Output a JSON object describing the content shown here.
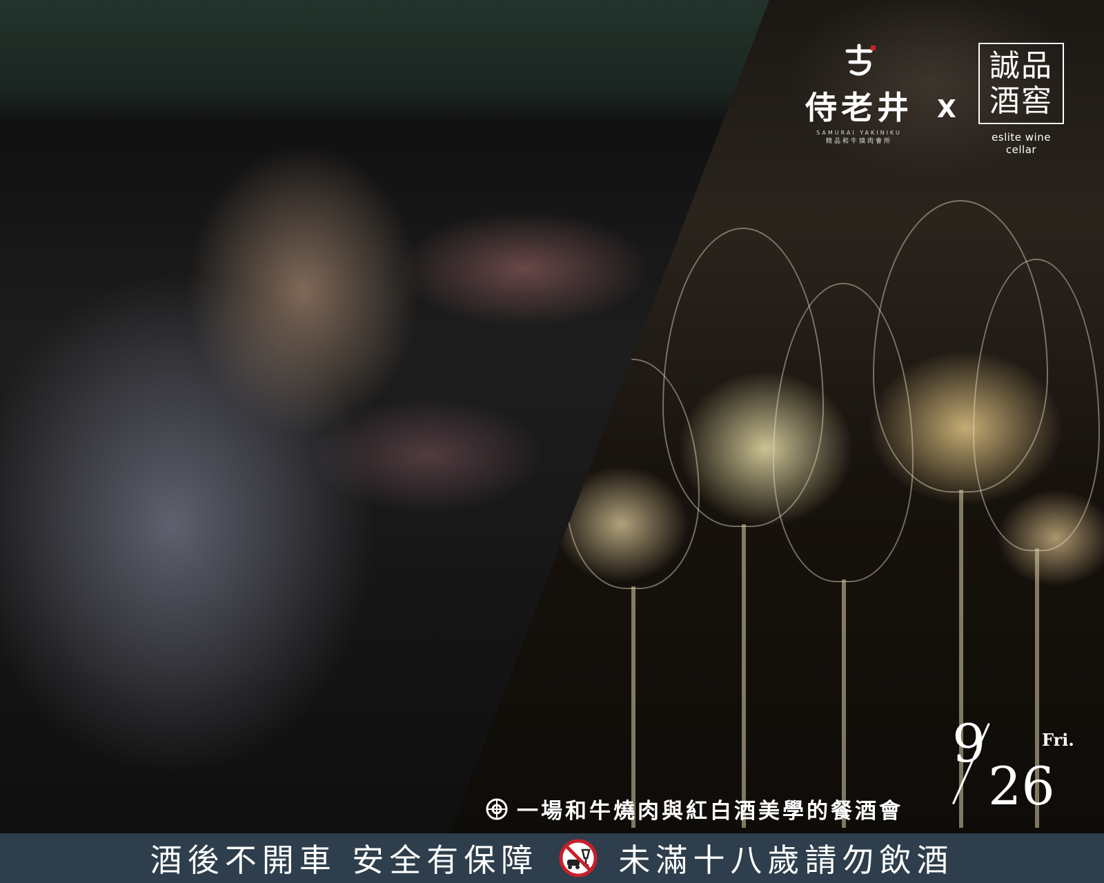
{
  "logo_left": {
    "name": "侍老井",
    "en": "SAMURAI YAKINIKU",
    "sub": "精品和牛燒肉會所"
  },
  "separator": "X",
  "logo_right": {
    "chars": [
      "誠品",
      "酒窖"
    ],
    "en": "eslite wine cellar"
  },
  "event": {
    "tagline": "一場和牛燒肉與紅白酒美學的餐酒會",
    "month": "9",
    "day": "26",
    "weekday": "Fri."
  },
  "warning": {
    "left": "酒後不開車 安全有保障",
    "icon": "no-drink-driving-icon",
    "right": "未滿十八歲請勿飲酒"
  },
  "colors": {
    "band": "#2e3e4c",
    "text": "#ffffff",
    "icon_red": "#c8202a"
  }
}
